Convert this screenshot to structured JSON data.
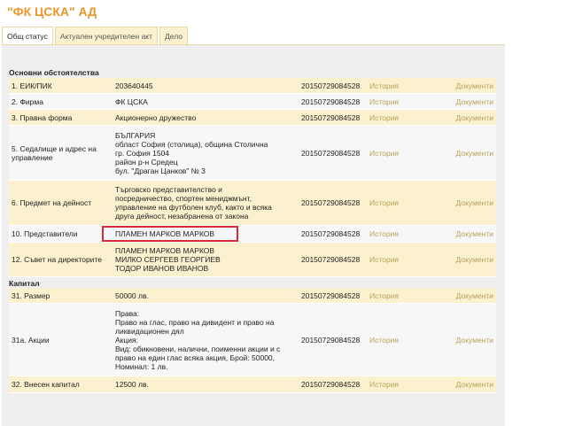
{
  "company": {
    "title": "\"ФК ЦСКА\" АД"
  },
  "tabs": [
    {
      "label": "Общ статус",
      "active": true
    },
    {
      "label": "Актуален учредителен акт",
      "active": false
    },
    {
      "label": "Дело",
      "active": false
    }
  ],
  "sections": {
    "main": "Основни обстоятелства",
    "capital": "Капитал"
  },
  "link_labels": {
    "history": "История",
    "documents": "Документи"
  },
  "rows": [
    {
      "num": "1.  ЕИК/ПИК",
      "value": [
        "203640445"
      ],
      "stamp": "20150729084528"
    },
    {
      "num": "2.  Фирма",
      "value": [
        "ФК ЦСКА"
      ],
      "stamp": "20150729084528"
    },
    {
      "num": "3.  Правна форма",
      "value": [
        "Акционерно дружество"
      ],
      "stamp": "20150729084528"
    },
    {
      "num": "5.  Седалище и адрес на управление",
      "value": [
        "БЪЛГАРИЯ",
        "област София (столица), община Столична",
        "гр. София 1504",
        "район р-н Средец",
        "бул. \"Драган Цанков\" № 3"
      ],
      "stamp": "20150729084528"
    },
    {
      "num": "6.  Предмет на дейност",
      "value": [
        "Търговско представителство и",
        "посредничество, спортен мениджмънт,",
        "управление на футболен клуб, както и всяка",
        "друга дейност, незабранена от закона"
      ],
      "stamp": "20150729084528"
    },
    {
      "num": "10.  Представители",
      "value": [
        "ПЛАМЕН МАРКОВ МАРКОВ"
      ],
      "stamp": "20150729084528"
    },
    {
      "num": "12.  Съвет на директорите",
      "value": [
        "ПЛАМЕН МАРКОВ МАРКОВ",
        "МИЛКО СЕРГЕЕВ ГЕОРГИЕВ",
        "ТОДОР ИВАНОВ ИВАНОВ"
      ],
      "stamp": "20150729084528"
    },
    {
      "num": "31.  Размер",
      "value": [
        "50000 лв."
      ],
      "stamp": "20150729084528"
    },
    {
      "num": "31а.  Акции",
      "value": [
        "Права:",
        "Право на глас, право на дивидент и право на",
        "ликвидационен дял",
        "Акция:",
        "Вид: обикновени, налични, поименни акции и с",
        "право на един глас всяка акция, Брой: 50000,",
        "Номинал: 1 лв."
      ],
      "stamp": "20150729084528"
    },
    {
      "num": "32.  Внесен капитал",
      "value": [
        "12500 лв."
      ],
      "stamp": "20150729084528"
    }
  ],
  "colors": {
    "title": "#e8962a",
    "link": "#b8a25a",
    "highlight": "#d9282f",
    "row_shaded": "#fbf1cf"
  }
}
